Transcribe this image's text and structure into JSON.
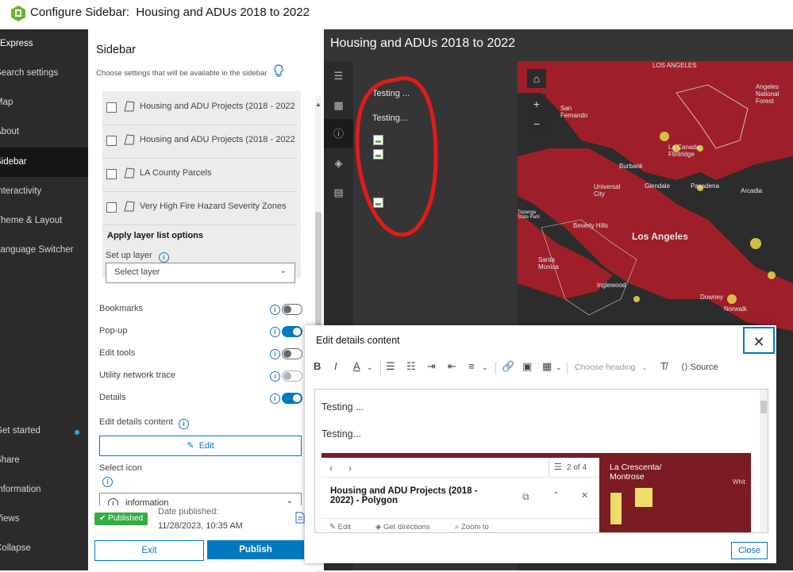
{
  "header": {
    "title": "Configure Sidebar:",
    "subtitle": "Housing and ADUs 2018 to 2022"
  },
  "nav": {
    "brand": "Express",
    "items": [
      "Search settings",
      "Map",
      "About",
      "Sidebar",
      "Interactivity",
      "Theme & Layout",
      "Language Switcher"
    ],
    "bottom_items": [
      "Get started",
      "Share",
      "Information",
      "Views",
      "Collapse"
    ]
  },
  "config": {
    "title": "Sidebar",
    "subtitle": "Choose settings that will be available in the sidebar",
    "layers": [
      "Housing and ADU Projects (2018 - 2022",
      "Housing and ADU Projects (2018 - 2022",
      "LA County Parcels",
      "Very High Fire Hazard Severity Zones"
    ],
    "apply_label": "Apply layer list options",
    "setup_label": "Set up layer",
    "select_placeholder": "Select layer",
    "options": [
      {
        "label": "Bookmarks",
        "on": false
      },
      {
        "label": "Pop-up",
        "on": true
      },
      {
        "label": "Edit tools",
        "on": false
      },
      {
        "label": "Utility network trace",
        "on": false
      },
      {
        "label": "Details",
        "on": true
      }
    ],
    "edit_details_label": "Edit details content",
    "edit_button": "Edit",
    "select_icon_label": "Select icon",
    "icon_value": "information",
    "published_badge": "Published",
    "date_published_label": "Date published:",
    "date_published_value": "11/28/2023, 10:35 AM",
    "exit_button": "Exit",
    "publish_button": "Publish"
  },
  "preview": {
    "title": "Housing and ADUs 2018 to 2022",
    "detail_lines": [
      "Testing ...",
      "Testing..."
    ],
    "map_labels": {
      "los_angeles_top": "LOS ANGELES",
      "angeles_forest": "Angeles National Forest",
      "san_fernando": "San Fernando",
      "canada": "La Canada Flintridge",
      "burbank": "Burbank",
      "glendale": "Glendale",
      "pasadena": "Pasadena",
      "arcadia": "Arcadia",
      "universal": "Universal City",
      "beverly": "Beverly Hills",
      "los_angeles": "Los Angeles",
      "santa_monica": "Santa Monica",
      "inglewood": "Inglewood",
      "downey": "Downey",
      "norwalk": "Norwalk",
      "topanga": "Topanga State Park"
    }
  },
  "modal": {
    "title": "Edit details content",
    "heading_placeholder": "Choose heading",
    "source_label": "Source",
    "editor_lines": [
      "Testing ...",
      "Testing..."
    ],
    "popup_counter": "2 of 4",
    "popup_title": "Housing and ADU Projects (2018 - 2022) - Polygon",
    "popup_actions": [
      "Edit",
      "Get directions",
      "Zoom to"
    ],
    "popup_map_label": "La Crescenta/ Montrose",
    "popup_white_label": "Whit",
    "close_button": "Close"
  },
  "colors": {
    "accent": "#0079c1",
    "published": "#35ac46",
    "map_red": "#9e1f2a",
    "annotation": "#e01b1b"
  }
}
